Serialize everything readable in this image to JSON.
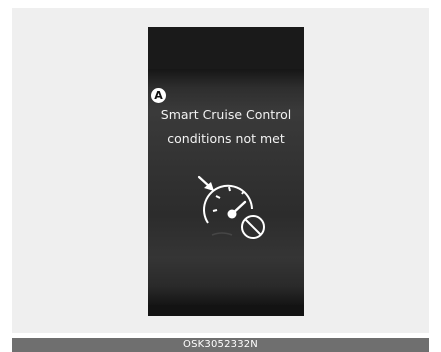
{
  "display": {
    "marker": "A",
    "message_line1": "Smart Cruise Control",
    "message_line2": "conditions not met",
    "icon": "smart-cruise-unavailable-icon"
  },
  "caption": "OSK3052332N"
}
